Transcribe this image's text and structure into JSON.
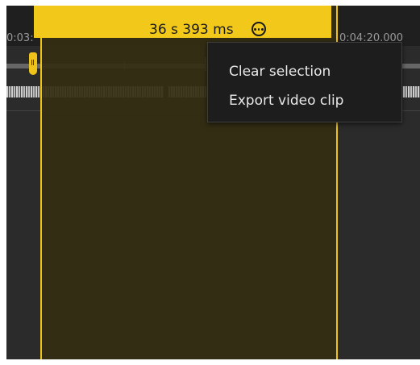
{
  "timeline": {
    "ruler_left_label": "0:03:",
    "ruler_right_label": "0:04:20.000"
  },
  "selection": {
    "duration_label": "36 s 393 ms",
    "more_icon": "more-horizontal-circle-icon",
    "accent_color": "#f2c91b"
  },
  "context_menu": {
    "items": [
      {
        "label": "Clear selection"
      },
      {
        "label": "Export video clip"
      }
    ]
  }
}
